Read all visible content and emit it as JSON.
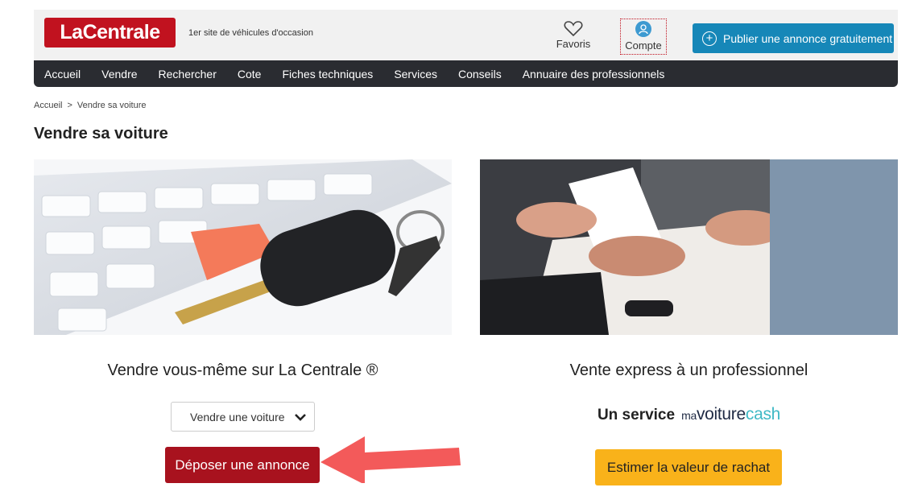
{
  "header": {
    "logo": "LaCentrale",
    "tagline": "1er site de véhicules d'occasion",
    "favorites_label": "Favoris",
    "account_label": "Compte",
    "publish_label": "Publier une annonce gratuitement"
  },
  "nav": {
    "items": [
      "Accueil",
      "Vendre",
      "Rechercher",
      "Cote",
      "Fiches techniques",
      "Services",
      "Conseils",
      "Annuaire des professionnels"
    ]
  },
  "breadcrumb": {
    "home": "Accueil",
    "separator": ">",
    "current": "Vendre sa voiture"
  },
  "page": {
    "title": "Vendre sa voiture"
  },
  "left": {
    "heading": "Vendre vous-même sur La Centrale ®",
    "select_value": "Vendre une voiture",
    "button_label": "Déposer une annonce"
  },
  "right": {
    "heading": "Vente express à un professionnel",
    "service_label": "Un service",
    "brand_ma": "ma",
    "brand_voiture": "voiture",
    "brand_cash": "cash",
    "button_label": "Estimer la valeur de rachat"
  },
  "colors": {
    "brand_red": "#c1121f",
    "button_red": "#a8121e",
    "publish_blue": "#1687b8",
    "nav_dark": "#2a2c31",
    "estimate_yellow": "#f9b21a",
    "arrow": "#f35a5a"
  },
  "icons": [
    "heart-icon",
    "user-icon",
    "plus-circle-icon",
    "chevron-down-icon",
    "arrow-left-icon"
  ]
}
